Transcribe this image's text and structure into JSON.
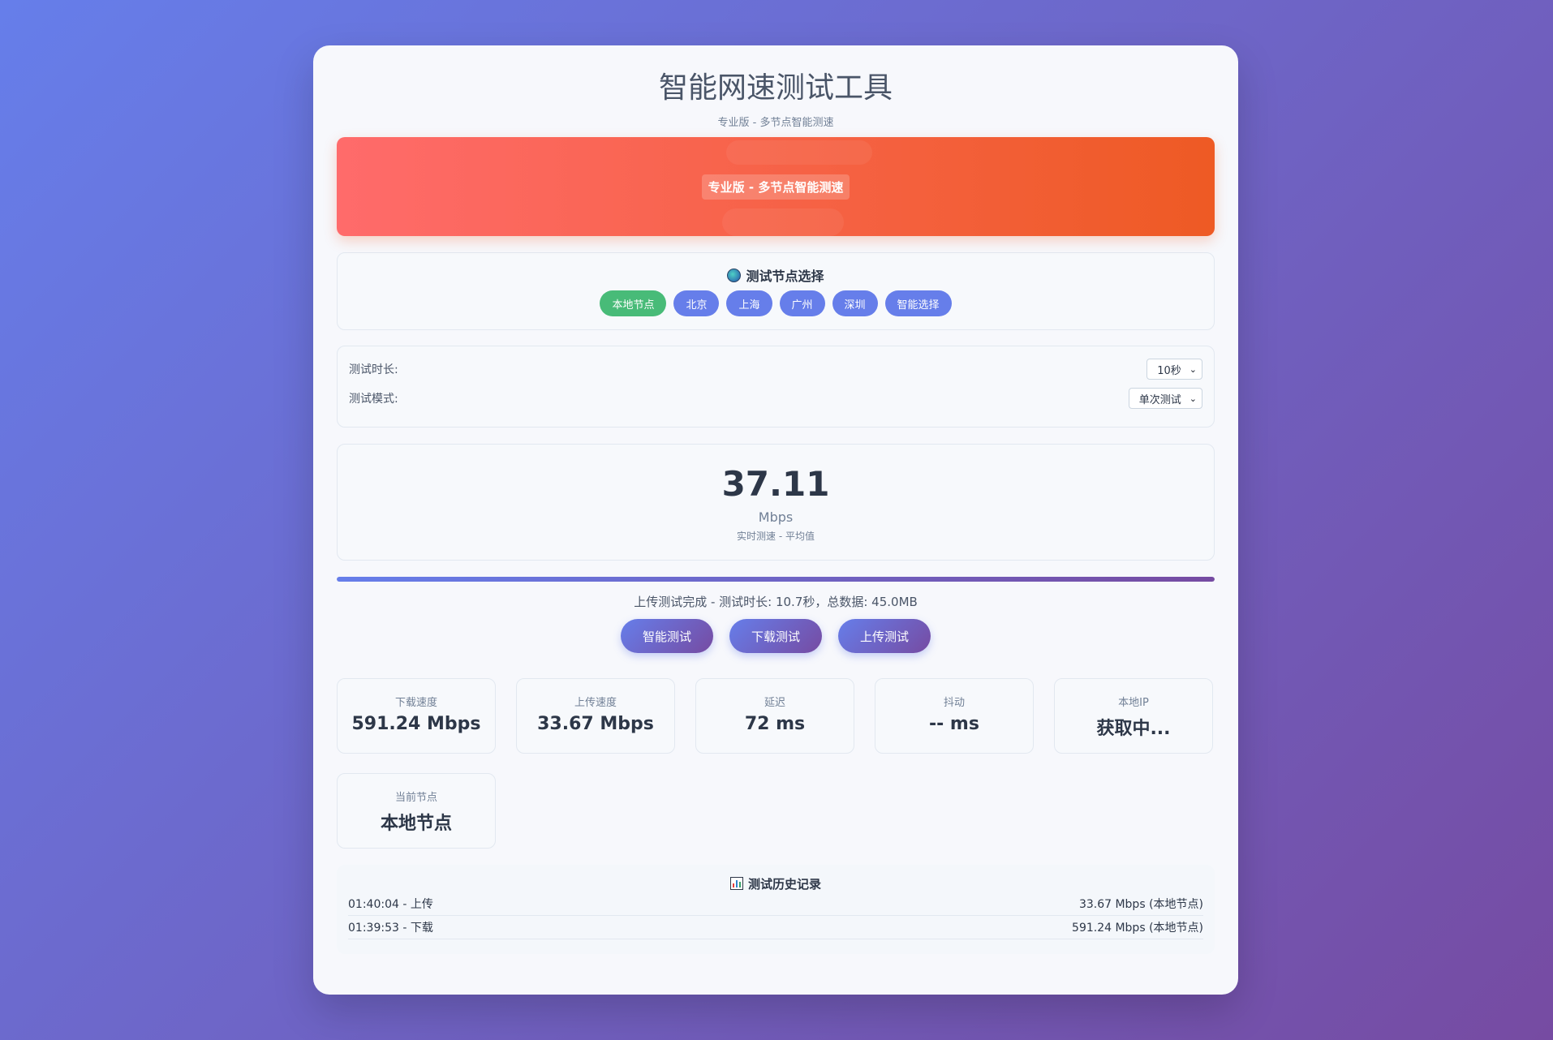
{
  "header": {
    "title": "智能网速测试工具",
    "subtitle": "专业版 - 多节点智能测速"
  },
  "banner": {
    "label": "专业版 - 多节点智能测速"
  },
  "nodes": {
    "title": "测试节点选择",
    "icon": "globe-icon",
    "items": [
      {
        "label": "本地节点",
        "active": true
      },
      {
        "label": "北京",
        "active": false
      },
      {
        "label": "上海",
        "active": false
      },
      {
        "label": "广州",
        "active": false
      },
      {
        "label": "深圳",
        "active": false
      },
      {
        "label": "智能选择",
        "active": false
      }
    ],
    "active_color": "#48bb78",
    "color": "#667eea"
  },
  "settings": {
    "duration_label": "测试时长:",
    "duration_value": "10秒",
    "mode_label": "测试模式:",
    "mode_value": "单次测试"
  },
  "speed": {
    "value": "37.11",
    "unit": "Mbps",
    "label": "实时测速 - 平均值"
  },
  "progress": {
    "percent": 100
  },
  "status": "上传测试完成 - 测试时长: 10.7秒，总数据: 45.0MB",
  "actions": {
    "smart": "智能测试",
    "download": "下载测试",
    "upload": "上传测试"
  },
  "stats": [
    {
      "label": "下载速度",
      "value": "591.24 Mbps"
    },
    {
      "label": "上传速度",
      "value": "33.67 Mbps"
    },
    {
      "label": "延迟",
      "value": "72 ms"
    },
    {
      "label": "抖动",
      "value": "-- ms"
    },
    {
      "label": "本地IP",
      "value": "获取中..."
    },
    {
      "label": "当前节点",
      "value": "本地节点"
    }
  ],
  "history": {
    "title": "测试历史记录",
    "icon": "bar-chart-icon",
    "rows": [
      {
        "left": "01:40:04 - 上传",
        "right": "33.67 Mbps (本地节点)"
      },
      {
        "left": "01:39:53 - 下载",
        "right": "591.24 Mbps (本地节点)"
      }
    ]
  }
}
